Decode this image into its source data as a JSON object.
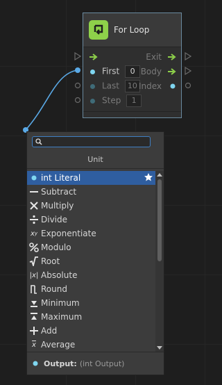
{
  "node": {
    "title": "For Loop",
    "exit_label": "Exit",
    "inputs": [
      {
        "label": "First",
        "value": "0"
      },
      {
        "label": "Last",
        "value": "10"
      },
      {
        "label": "Step",
        "value": "1"
      }
    ],
    "outputs": [
      {
        "label": "Body"
      },
      {
        "label": "Index"
      }
    ]
  },
  "finder": {
    "search_value": "",
    "title": "Unit",
    "items": [
      {
        "label": "int Literal",
        "icon": "dot-icon",
        "selected": true,
        "favorite": true
      },
      {
        "label": "Subtract",
        "icon": "minus-icon"
      },
      {
        "label": "Multiply",
        "icon": "multiply-icon"
      },
      {
        "label": "Divide",
        "icon": "divide-icon"
      },
      {
        "label": "Exponentiate",
        "icon": "exponent-icon"
      },
      {
        "label": "Modulo",
        "icon": "percent-icon"
      },
      {
        "label": "Root",
        "icon": "sqrt-icon"
      },
      {
        "label": "Absolute",
        "icon": "absolute-icon"
      },
      {
        "label": "Round",
        "icon": "round-icon"
      },
      {
        "label": "Minimum",
        "icon": "minimum-icon"
      },
      {
        "label": "Maximum",
        "icon": "maximum-icon"
      },
      {
        "label": "Add",
        "icon": "plus-icon"
      },
      {
        "label": "Average",
        "icon": "average-icon"
      }
    ],
    "footer": {
      "label": "Output:",
      "type": "(int Output)"
    }
  },
  "colors": {
    "accent_green": "#8ed14a",
    "port_cyan": "#7fd6f0",
    "selection_blue": "#2f5ea0",
    "wire_blue": "#5aa9e6"
  }
}
